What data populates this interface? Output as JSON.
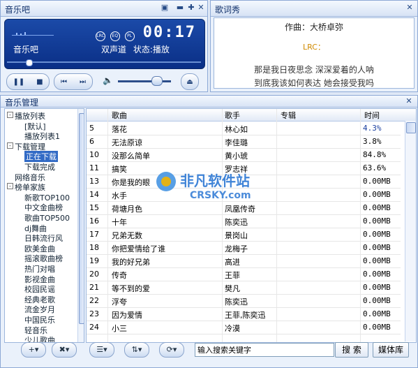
{
  "player": {
    "title": "音乐吧",
    "song_name": "音乐吧",
    "time": "00:17",
    "channel": "双声道",
    "status_label": "状态:",
    "status_value": "播放",
    "badges": [
      "LRC",
      "EQ",
      "PL"
    ],
    "progress": 0.1,
    "volume": 0.7
  },
  "lyrics": {
    "title": "歌词秀",
    "credit": "作曲：大桥卓弥",
    "lrc": "LRC：",
    "lines": [
      "那是我日夜思念 深深爱着的人呐",
      "到底我该如何表达 她会接受我吗"
    ]
  },
  "manager": {
    "title": "音乐管理",
    "tree": [
      {
        "label": "播放列表",
        "level": 0,
        "box": "-"
      },
      {
        "label": "[默认]",
        "level": 1
      },
      {
        "label": "播放列表1",
        "level": 1
      },
      {
        "label": "下载管理",
        "level": 0,
        "box": "-"
      },
      {
        "label": "正在下载",
        "level": 1,
        "selected": true
      },
      {
        "label": "下载完成",
        "level": 1
      },
      {
        "label": "网络音乐",
        "level": 0
      },
      {
        "label": "榜单家族",
        "level": 0,
        "box": "-"
      },
      {
        "label": "新歌TOP100",
        "level": 1
      },
      {
        "label": "中文金曲榜",
        "level": 1
      },
      {
        "label": "歌曲TOP500",
        "level": 1
      },
      {
        "label": "dj舞曲",
        "level": 1
      },
      {
        "label": "日韩流行风",
        "level": 1
      },
      {
        "label": "欧美金曲",
        "level": 1
      },
      {
        "label": "摇滚歌曲榜",
        "level": 1
      },
      {
        "label": "热门对唱",
        "level": 1
      },
      {
        "label": "影视金曲",
        "level": 1
      },
      {
        "label": "校园民谣",
        "level": 1
      },
      {
        "label": "经典老歌",
        "level": 1
      },
      {
        "label": "流金岁月",
        "level": 1
      },
      {
        "label": "中国民乐",
        "level": 1
      },
      {
        "label": "轻音乐",
        "level": 1
      },
      {
        "label": "少儿歌曲",
        "level": 1
      }
    ],
    "columns": {
      "song": "歌曲",
      "singer": "歌手",
      "album": "专辑",
      "time": "时间"
    },
    "rows": [
      {
        "num": "5",
        "song": "落花",
        "singer": "林心如",
        "album": "",
        "time": "4.3%",
        "time_color": "#1a3fa0"
      },
      {
        "num": "6",
        "song": "无法原谅",
        "singer": "李佳璐",
        "album": "",
        "time": "3.8%"
      },
      {
        "num": "10",
        "song": "没那么简单",
        "singer": "黄小琥",
        "album": "",
        "time": "84.8%"
      },
      {
        "num": "11",
        "song": "搞笑",
        "singer": "罗志祥",
        "album": "",
        "time": "63.6%"
      },
      {
        "num": "13",
        "song": "你是我的眼",
        "singer": "",
        "album": "",
        "time": "0.00MB"
      },
      {
        "num": "14",
        "song": "水手",
        "singer": "",
        "album": "",
        "time": "0.00MB"
      },
      {
        "num": "15",
        "song": "荷塘月色",
        "singer": "凤凰传奇",
        "album": "",
        "time": "0.00MB"
      },
      {
        "num": "16",
        "song": "十年",
        "singer": "陈奕迅",
        "album": "",
        "time": "0.00MB"
      },
      {
        "num": "17",
        "song": "兄弟无数",
        "singer": "景岗山",
        "album": "",
        "time": "0.00MB"
      },
      {
        "num": "18",
        "song": "你把爱情给了谁",
        "singer": "龙梅子",
        "album": "",
        "time": "0.00MB"
      },
      {
        "num": "19",
        "song": "我的好兄弟",
        "singer": "高进",
        "album": "",
        "time": "0.00MB"
      },
      {
        "num": "20",
        "song": "传奇",
        "singer": "王菲",
        "album": "",
        "time": "0.00MB"
      },
      {
        "num": "21",
        "song": "等不到的爱",
        "singer": "樊凡",
        "album": "",
        "time": "0.00MB"
      },
      {
        "num": "22",
        "song": "浮夸",
        "singer": "陈奕迅",
        "album": "",
        "time": "0.00MB"
      },
      {
        "num": "23",
        "song": "因为爱情",
        "singer": "王菲,陈奕迅",
        "album": "",
        "time": "0.00MB"
      },
      {
        "num": "24",
        "song": "小三",
        "singer": "冷漠",
        "album": "",
        "time": "0.00MB"
      }
    ]
  },
  "toolbar": {
    "add_label": "+▾",
    "delete_label": "✖▾",
    "list_label": "☰▾",
    "sort_label": "⇅▾",
    "mode_label": "⟳▾",
    "search_value": "输入搜索关键字",
    "search_button": "搜 索",
    "library_button": "媒体库"
  },
  "watermark": {
    "brand_cn": "非凡软件站",
    "brand_en": "CRSKY.com"
  }
}
